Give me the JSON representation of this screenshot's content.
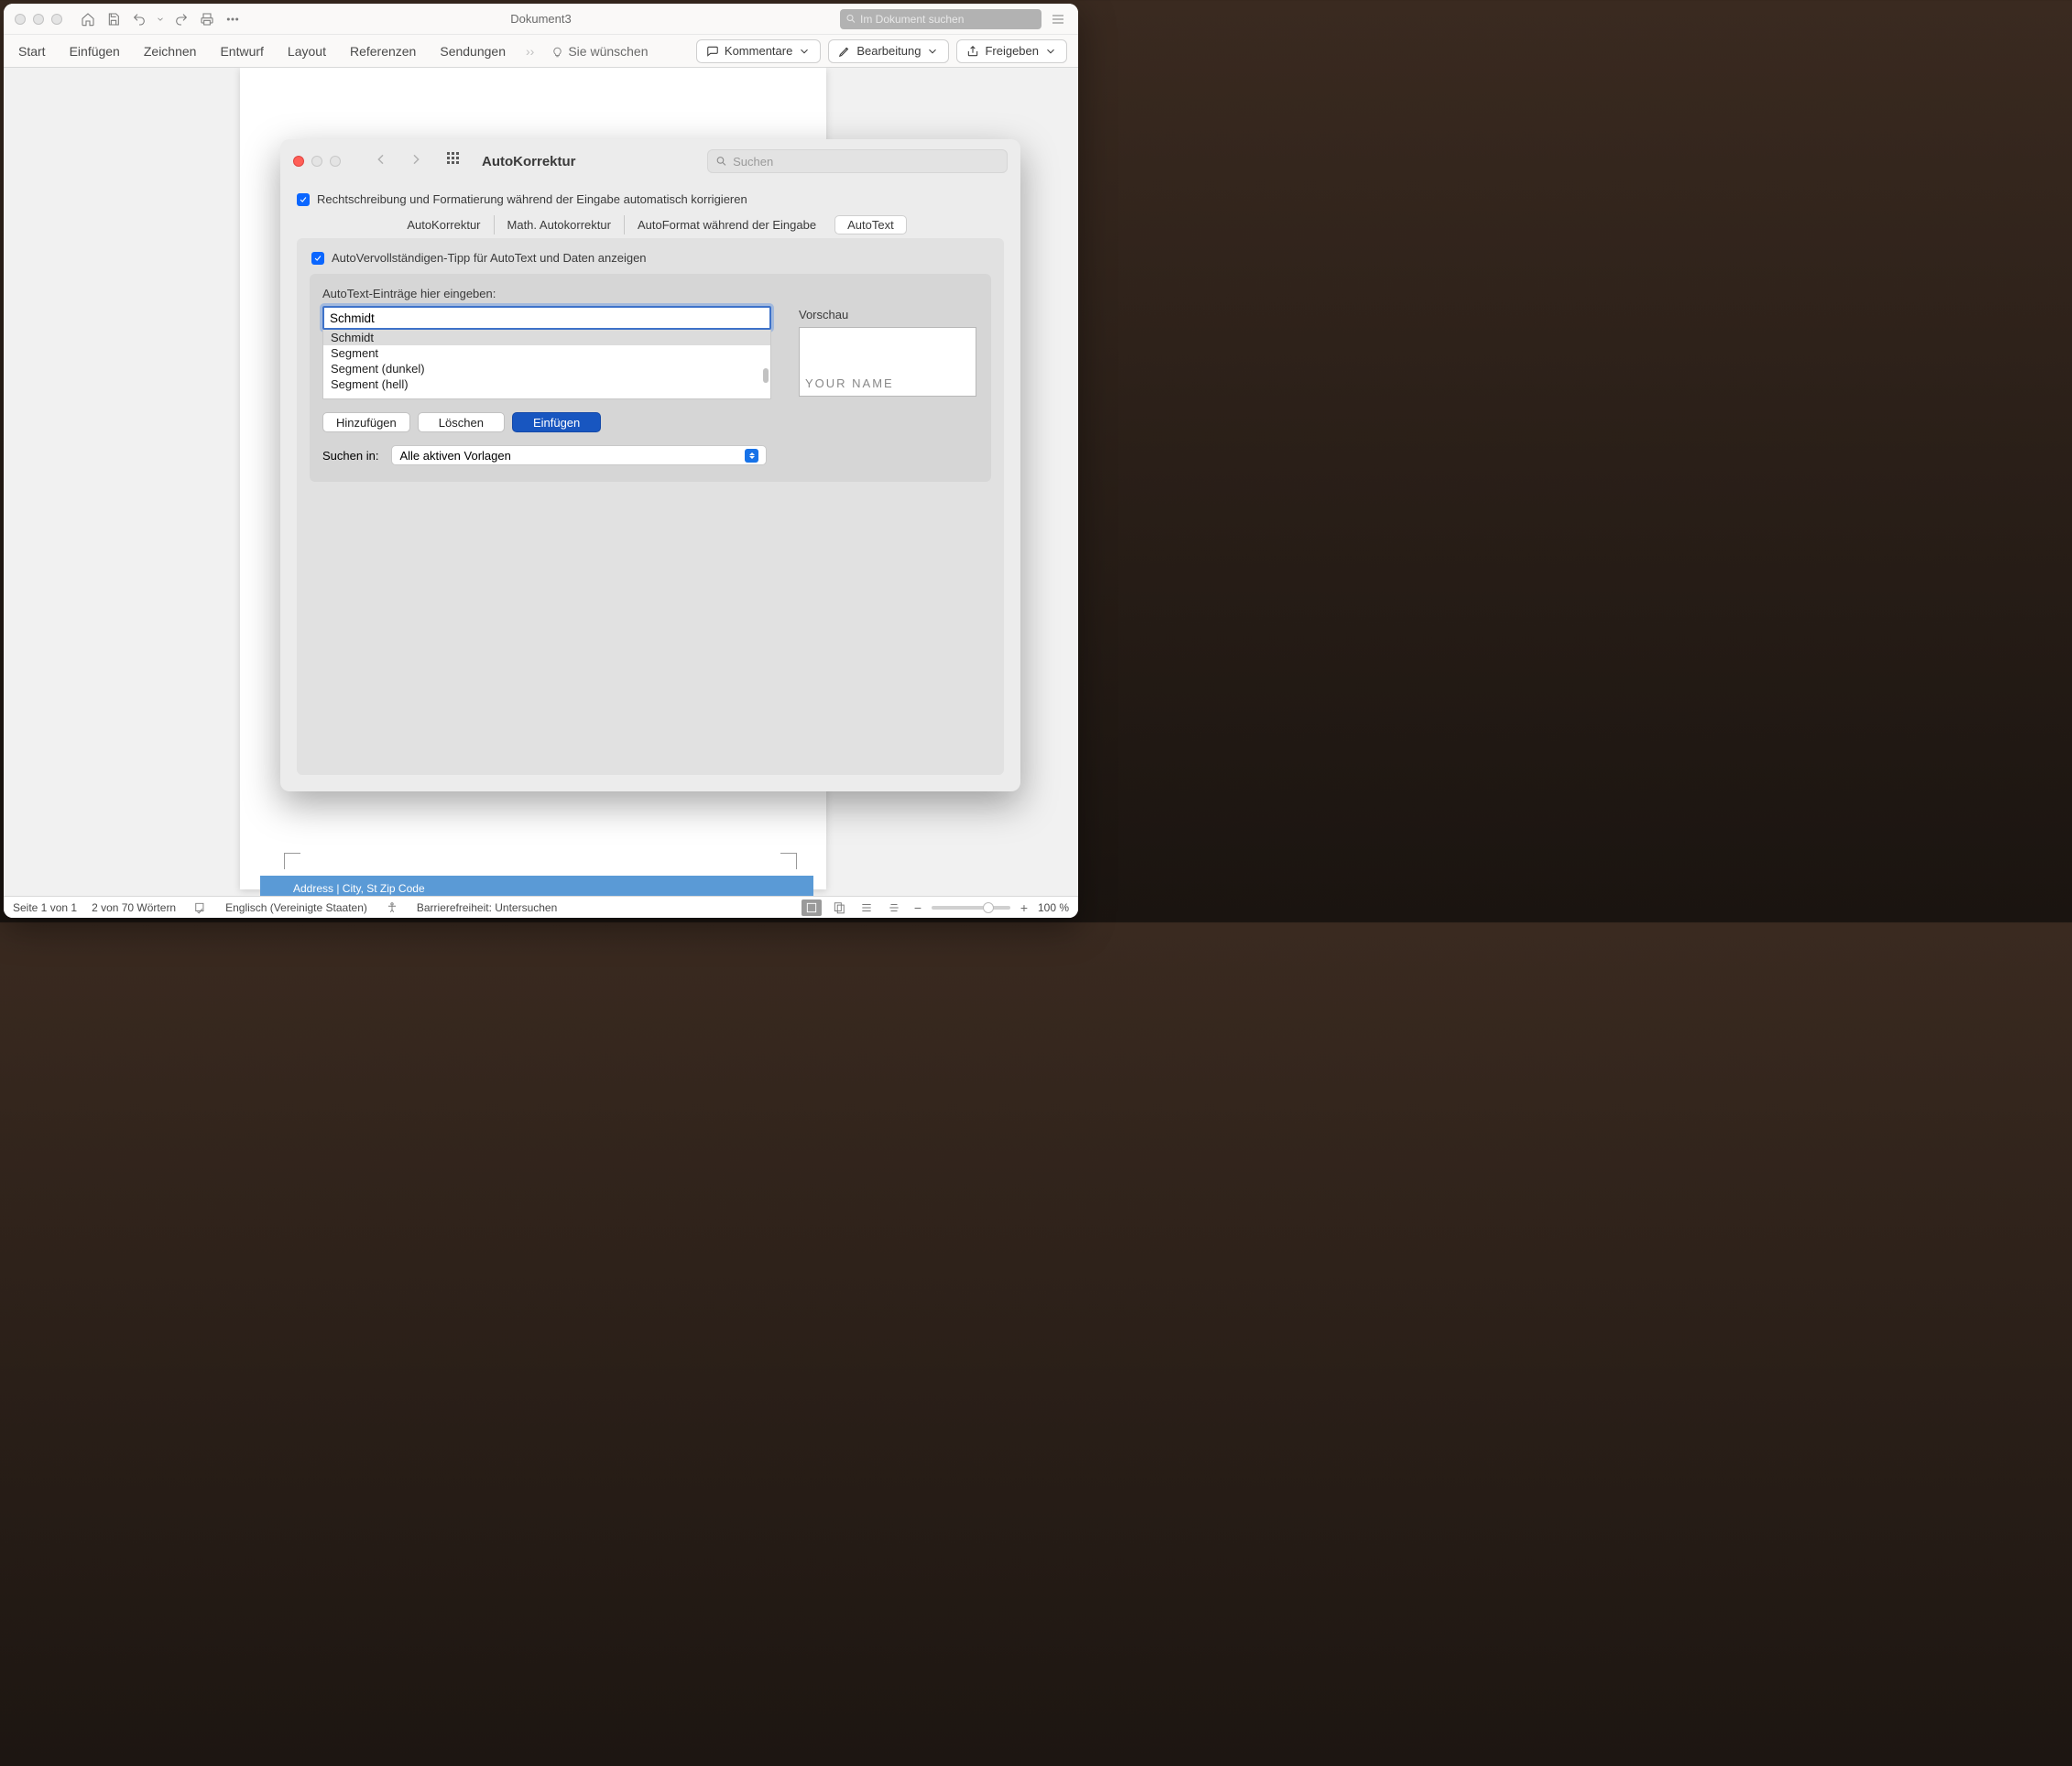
{
  "title": "Dokument3",
  "search_placeholder": "Im Dokument suchen",
  "ribbon": {
    "tabs": [
      "Start",
      "Einfügen",
      "Zeichnen",
      "Entwurf",
      "Layout",
      "Referenzen",
      "Sendungen"
    ],
    "tell_me": "Sie wünschen",
    "comments": "Kommentare",
    "editing": "Bearbeitung",
    "share": "Freigeben"
  },
  "dialog": {
    "title": "AutoKorrektur",
    "search_placeholder": "Suchen",
    "chk1": "Rechtschreibung und Formatierung während der Eingabe automatisch korrigieren",
    "tabs": [
      "AutoKorrektur",
      "Math. Autokorrektur",
      "AutoFormat während der Eingabe",
      "AutoText"
    ],
    "active_tab": 3,
    "chk2": "AutoVervollständigen-Tipp für AutoText und Daten anzeigen",
    "entries_label": "AutoText-Einträge hier eingeben:",
    "input_value": "Schmidt",
    "list": [
      "Schmidt",
      "Segment",
      "Segment (dunkel)",
      "Segment (hell)"
    ],
    "preview_label": "Vorschau",
    "preview_text": "YOUR NAME",
    "btn_add": "Hinzufügen",
    "btn_delete": "Löschen",
    "btn_insert": "Einfügen",
    "lookin_label": "Suchen in:",
    "lookin_value": "Alle aktiven Vorlagen"
  },
  "doc": {
    "address": "Address | City, St Zip Code"
  },
  "status": {
    "page": "Seite 1 von 1",
    "words": "2 von 70 Wörtern",
    "lang": "Englisch (Vereinigte Staaten)",
    "a11y": "Barrierefreiheit: Untersuchen",
    "zoom": "100 %"
  }
}
